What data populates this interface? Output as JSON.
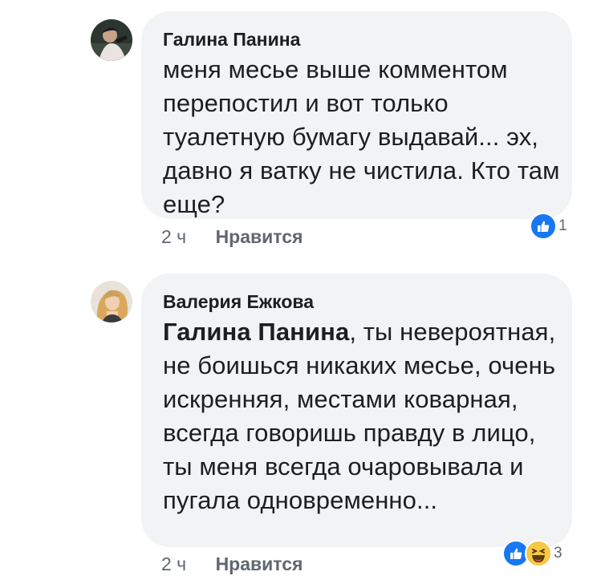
{
  "comments": [
    {
      "author": "Галина Панина",
      "text": "меня месье выше комментом перепостил и вот только туалетную бумагу выдавай... эх, давно я ватку не чистила. Кто там еще?",
      "time": "2 ч",
      "like_label": "Нравится",
      "reaction_count": "1",
      "reactions": [
        "like-icon"
      ]
    },
    {
      "author": "Валерия Ежкова",
      "mention": "Галина Панина",
      "text": ", ты невероятная, не боишься никаких месье, очень искренняя, местами коварная, всегда говоришь правду в лицо, ты меня всегда очаровывала и пугала одновременно...",
      "time": "2 ч",
      "like_label": "Нравится",
      "reaction_count": "3",
      "reactions": [
        "like-icon",
        "haha-icon"
      ]
    }
  ],
  "colors": {
    "bubble": "#f2f3f5",
    "like_blue": "#1877f2",
    "haha_yellow": "#f7c844",
    "meta_gray": "#606770"
  }
}
